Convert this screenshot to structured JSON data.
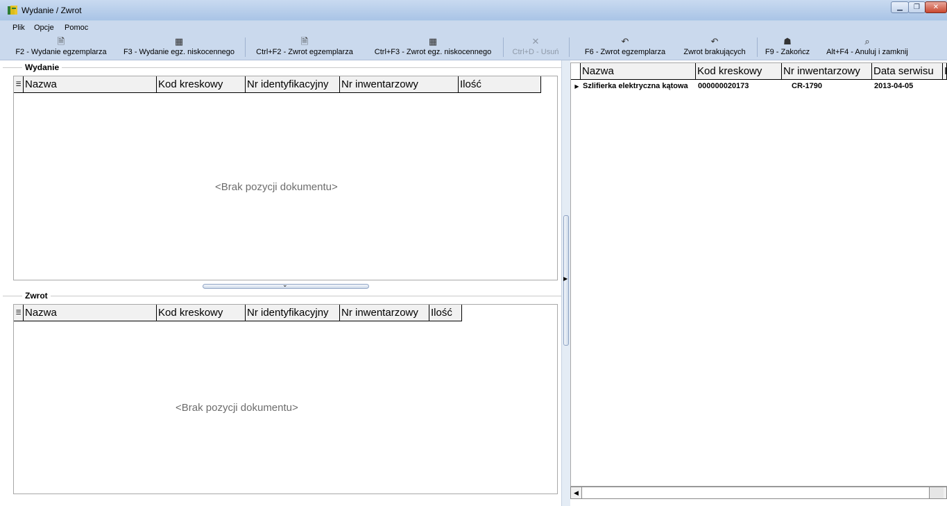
{
  "window": {
    "title": "Wydanie / Zwrot"
  },
  "menu": [
    {
      "label": "Plik"
    },
    {
      "label": "Opcje"
    },
    {
      "label": "Pomoc"
    }
  ],
  "toolbar": {
    "issue_item": "F2 - Wydanie egzemplarza",
    "issue_low_value": "F3 - Wydanie egz. niskocennego",
    "return_item": "Ctrl+F2 - Zwrot egzemplarza",
    "return_low_value": "Ctrl+F3 - Zwrot egz. niskocennego",
    "delete": "Ctrl+D - Usuń",
    "return_item_f6": "F6 - Zwrot egzemplarza",
    "return_missing": "Zwrot  brakujących",
    "finish": "F9 - Zakończ",
    "cancel_close": "Alt+F4 - Anuluj i zamknij"
  },
  "issue_section": {
    "caption": "Wydanie",
    "columns": [
      "Nazwa",
      "Kod kreskowy",
      "Nr identyfikacyjny",
      "Nr inwentarzowy",
      "Ilość"
    ],
    "empty_message": "<Brak pozycji dokumentu>"
  },
  "return_section": {
    "caption": "Zwrot",
    "columns": [
      "Nazwa",
      "Kod kreskowy",
      "Nr identyfikacyjny",
      "Nr inwentarzowy",
      "Ilość"
    ],
    "empty_message": "<Brak pozycji dokumentu>"
  },
  "right_grid": {
    "columns": [
      "Nazwa",
      "Kod kreskowy",
      "Nr inwentarzowy",
      "Data serwisu",
      "I"
    ],
    "rows": [
      {
        "name": "Szlifierka elektryczna kątowa",
        "barcode": "000000020173",
        "inventory": "CR-1790",
        "service_date": "2013-04-05"
      }
    ]
  },
  "colors": {
    "titlebar": "#b9d1ea",
    "toolbar": "#cad9ed",
    "empty_text": "#6d6d6d"
  }
}
